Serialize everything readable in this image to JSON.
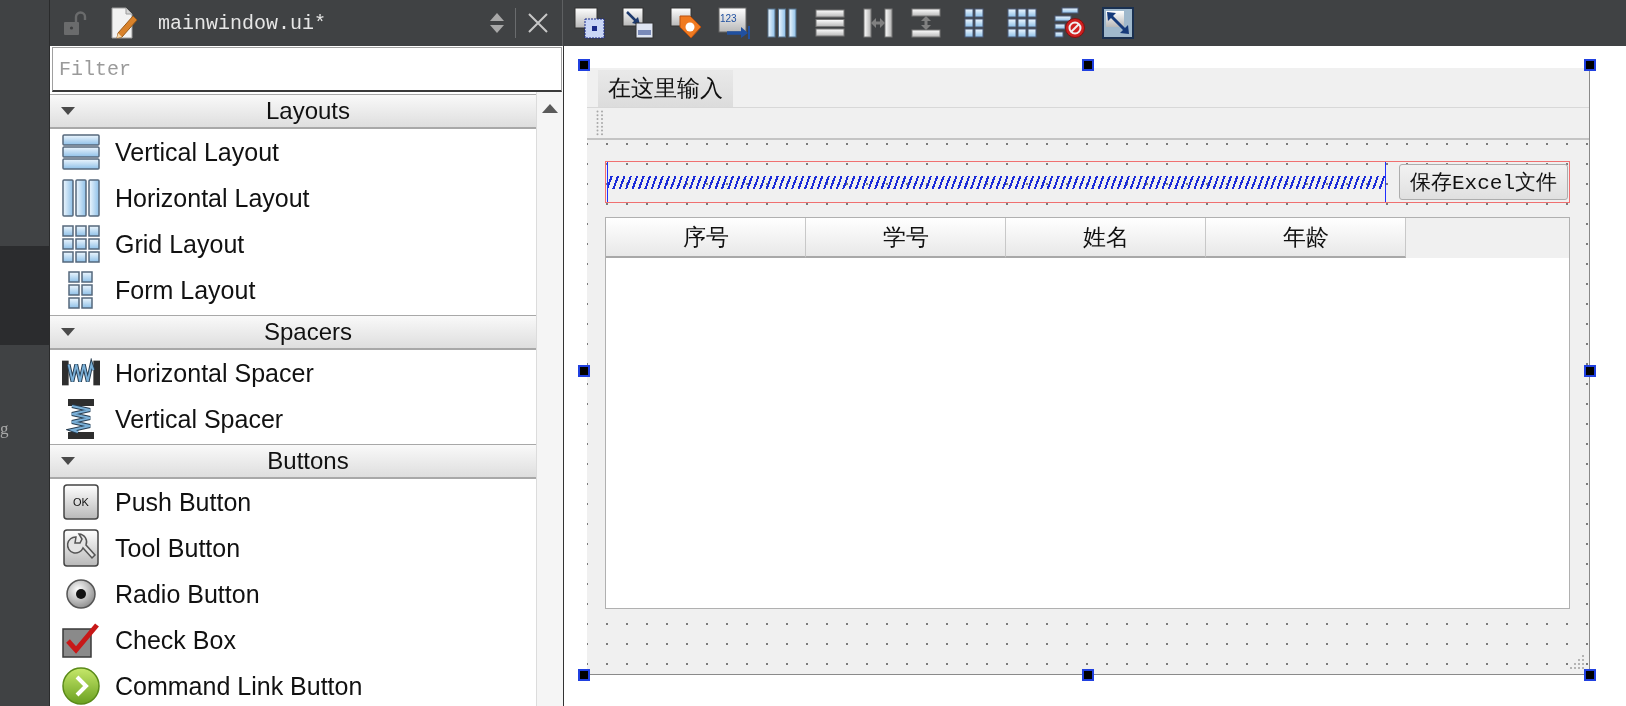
{
  "mode_bar": {
    "items": [
      {
        "selected": true
      },
      {
        "label": "g",
        "selected": false
      }
    ]
  },
  "editor_bar": {
    "locked": false,
    "file_name": "mainwindow.ui*"
  },
  "form_toolbar": {
    "items": [
      {
        "kind": "edit-widgets"
      },
      {
        "kind": "edit-signals"
      },
      {
        "kind": "edit-buddies"
      },
      {
        "kind": "edit-tab-order",
        "icon_text": "123"
      },
      {
        "kind": "layout-horizontal"
      },
      {
        "kind": "layout-vertical"
      },
      {
        "kind": "splitter-horizontal"
      },
      {
        "kind": "splitter-vertical"
      },
      {
        "kind": "layout-form"
      },
      {
        "kind": "layout-grid"
      },
      {
        "kind": "break-layout"
      },
      {
        "kind": "adjust-size"
      }
    ]
  },
  "widget_box": {
    "filter": {
      "placeholder": "Filter"
    },
    "groups": [
      {
        "title": "Layouts",
        "expanded": true,
        "items": [
          {
            "label": "Vertical Layout",
            "kind": "vertical-layout"
          },
          {
            "label": "Horizontal Layout",
            "kind": "horizontal-layout"
          },
          {
            "label": "Grid Layout",
            "kind": "grid-layout"
          },
          {
            "label": "Form Layout",
            "kind": "form-layout"
          }
        ]
      },
      {
        "title": "Spacers",
        "expanded": true,
        "items": [
          {
            "label": "Horizontal Spacer",
            "kind": "horizontal-spacer"
          },
          {
            "label": "Vertical Spacer",
            "kind": "vertical-spacer"
          }
        ]
      },
      {
        "title": "Buttons",
        "expanded": true,
        "items": [
          {
            "label": "Push Button",
            "kind": "push-button",
            "icon_text": "OK"
          },
          {
            "label": "Tool Button",
            "kind": "tool-button"
          },
          {
            "label": "Radio Button",
            "kind": "radio-button"
          },
          {
            "label": "Check Box",
            "kind": "check-box"
          },
          {
            "label": "Command Link Button",
            "kind": "command-link"
          }
        ]
      }
    ]
  },
  "form": {
    "menu_bar": {
      "items": [
        {
          "label": "在这里输入"
        }
      ]
    },
    "save_button": {
      "label": "保存Excel文件"
    },
    "table": {
      "columns": [
        "序号",
        "学号",
        "姓名",
        "年龄"
      ]
    }
  }
}
